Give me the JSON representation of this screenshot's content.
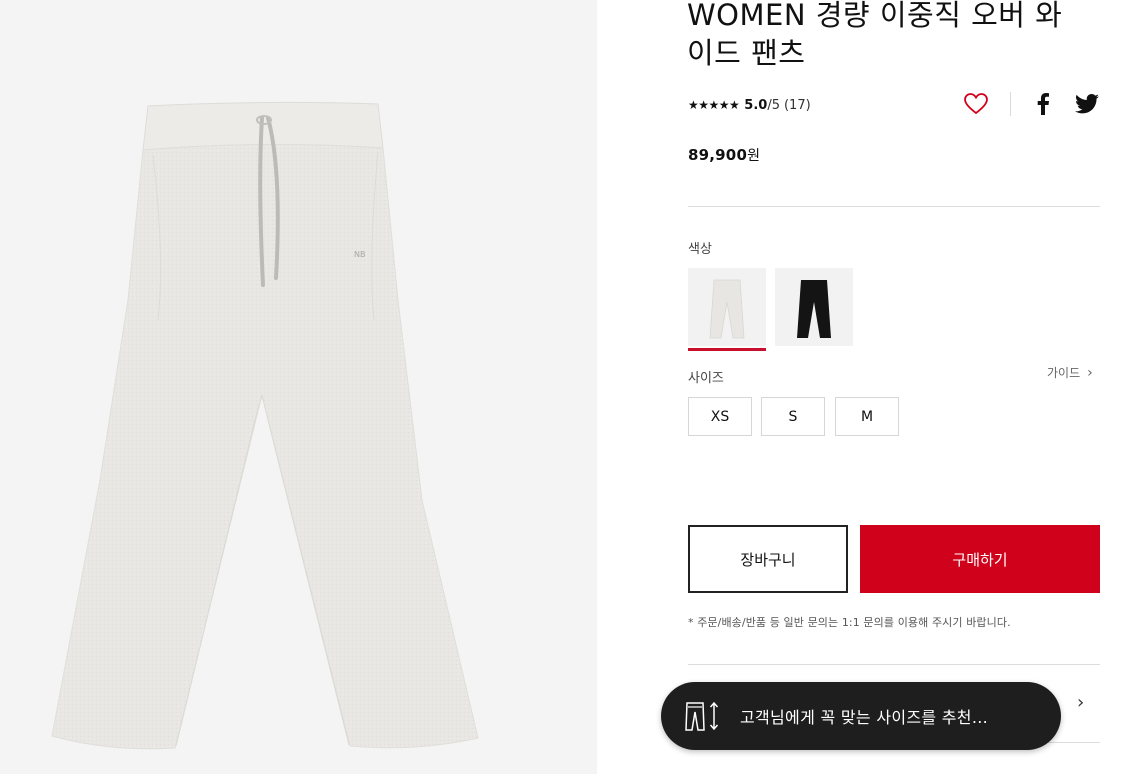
{
  "product": {
    "title": "WOMEN 경량 이중직 오버 와이드 팬츠",
    "image_alt": "light gray wide pants",
    "rating": {
      "stars": "★★★★★",
      "score": "5.0",
      "out_of": "/5",
      "count": "(17)"
    },
    "price_value": "89,900",
    "price_unit": "원"
  },
  "share": {
    "wishlist_icon": "heart-icon",
    "facebook_icon": "facebook-icon",
    "twitter_icon": "twitter-icon"
  },
  "color": {
    "label": "색상",
    "options": [
      {
        "name": "light-gray",
        "hex": "#e8e6e2",
        "selected": true
      },
      {
        "name": "black",
        "hex": "#141414",
        "selected": false
      }
    ]
  },
  "size": {
    "label": "사이즈",
    "guide_label": "가이드",
    "options": [
      "XS",
      "S",
      "M"
    ]
  },
  "actions": {
    "cart_label": "장바구니",
    "buy_label": "구매하기"
  },
  "notice": "* 주문/배송/반품 등 일반 문의는 1:1 문의를 이용해 주시기 바랍니다.",
  "size_recommend": {
    "text": "고객님에게 꼭 맞는 사이즈를 추천...",
    "icon": "pants-size-icon"
  },
  "colors": {
    "accent": "#c8102e",
    "buy_button": "#d0021b",
    "toast_bg": "#1e1e1e",
    "image_bg": "#f4f4f4"
  }
}
